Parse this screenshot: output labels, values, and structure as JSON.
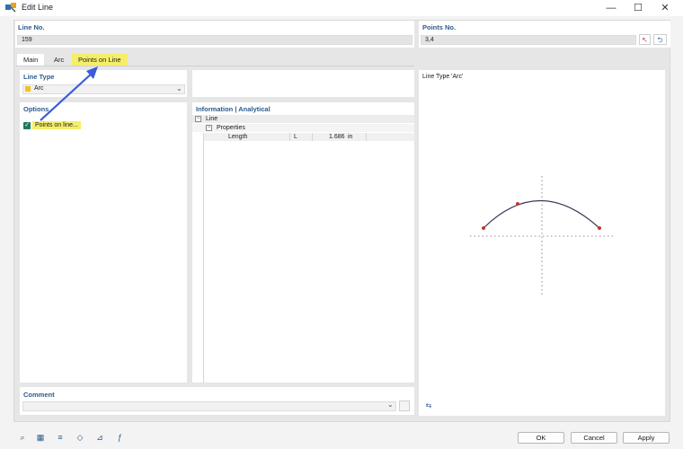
{
  "window": {
    "title": "Edit Line",
    "minimize": "—",
    "maximize": "☐",
    "close": "✕"
  },
  "line_no": {
    "label": "Line No.",
    "value": "159"
  },
  "points_no": {
    "label": "Points No.",
    "value": "3,4"
  },
  "tabs": [
    {
      "label": "Main"
    },
    {
      "label": "Arc"
    },
    {
      "label": "Points on Line"
    }
  ],
  "line_type": {
    "label": "Line Type",
    "value": "Arc",
    "swatch_color": "#f0c419"
  },
  "options": {
    "label": "Options",
    "points_on_line": "Points on line...",
    "highlight_color": "#f5ee6a"
  },
  "info": {
    "label": "Information | Analytical",
    "tree_root": "Line",
    "tree_child": "Properties",
    "row": {
      "name": "Length",
      "symbol": "L",
      "value": "1.686",
      "unit": "in"
    }
  },
  "preview": {
    "label": "Line Type 'Arc'"
  },
  "comment": {
    "label": "Comment",
    "value": ""
  },
  "buttons": {
    "ok": "OK",
    "cancel": "Cancel",
    "apply": "Apply"
  },
  "toolbar_icons": [
    "search-icon",
    "number-icon",
    "formula-icon",
    "view-icon",
    "info-icon",
    "function-icon"
  ]
}
